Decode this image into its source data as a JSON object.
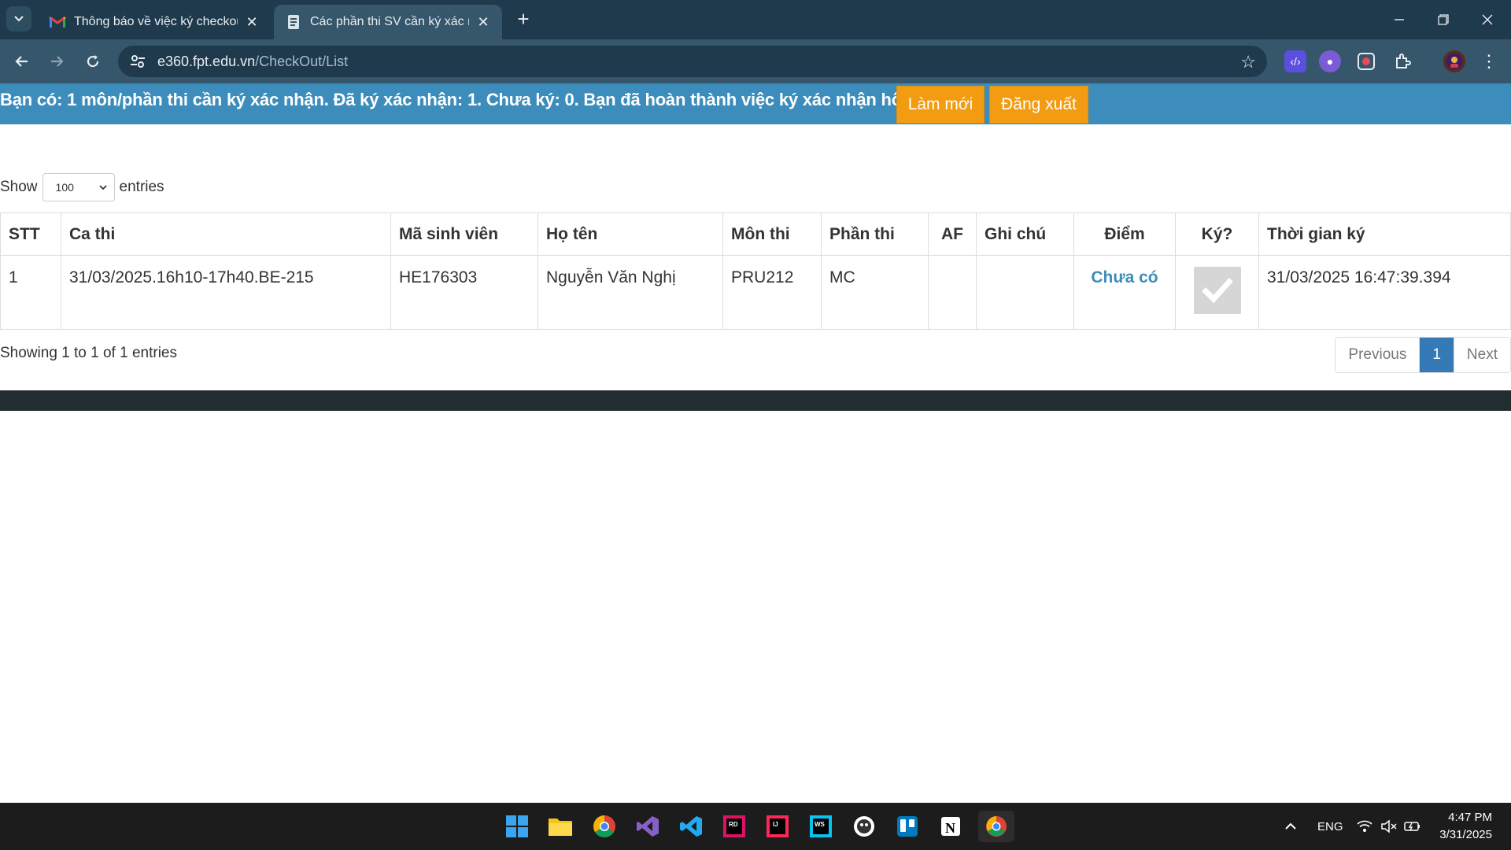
{
  "browser": {
    "tabs": [
      {
        "title": "Thông báo về việc ký checkout",
        "active": false
      },
      {
        "title": "Các phần thi SV cần ký xác nhận",
        "active": true
      }
    ],
    "url_host": "e360.fpt.edu.vn",
    "url_path": "/CheckOut/List"
  },
  "banner": {
    "message": "Bạn có: 1 môn/phần thi cần ký xác nhận. Đã ký xác nhận: 1. Chưa ký: 0. Bạn đã hoàn thành việc ký xác nhận hôm nay",
    "refresh_label": "Làm mới",
    "logout_label": "Đăng xuất",
    "color": "#3c8dbc",
    "button_color": "#f39c12"
  },
  "length_menu": {
    "show_label": "Show",
    "selected": "100",
    "entries_label": "entries"
  },
  "table": {
    "headers": [
      "STT",
      "Ca thi",
      "Mã sinh viên",
      "Họ tên",
      "Môn thi",
      "Phần thi",
      "AF",
      "Ghi chú",
      "Điểm",
      "Ký?",
      "Thời gian ký"
    ],
    "rows": [
      {
        "stt": "1",
        "ca_thi": "31/03/2025.16h10-17h40.BE-215",
        "ma_sv": "HE176303",
        "ho_ten": "Nguyễn Văn Nghị",
        "mon_thi": "PRU212",
        "phan_thi": "MC",
        "af": "",
        "ghi_chu": "",
        "diem": "Chưa có",
        "ky": true,
        "thoi_gian_ky": "31/03/2025 16:47:39.394"
      }
    ]
  },
  "info": "Showing 1 to 1 of 1 entries",
  "pagination": {
    "previous": "Previous",
    "current": "1",
    "next": "Next"
  },
  "taskbar": {
    "language": "ENG",
    "time": "4:47 PM",
    "date": "3/31/2025",
    "apps": [
      "windows-start-icon",
      "file-explorer-icon",
      "chrome-icon",
      "visual-studio-icon",
      "vscode-icon",
      "rider-icon",
      "intellij-icon",
      "webstorm-icon",
      "github-desktop-icon",
      "trello-icon",
      "notion-icon",
      "chrome-profile-icon"
    ]
  }
}
